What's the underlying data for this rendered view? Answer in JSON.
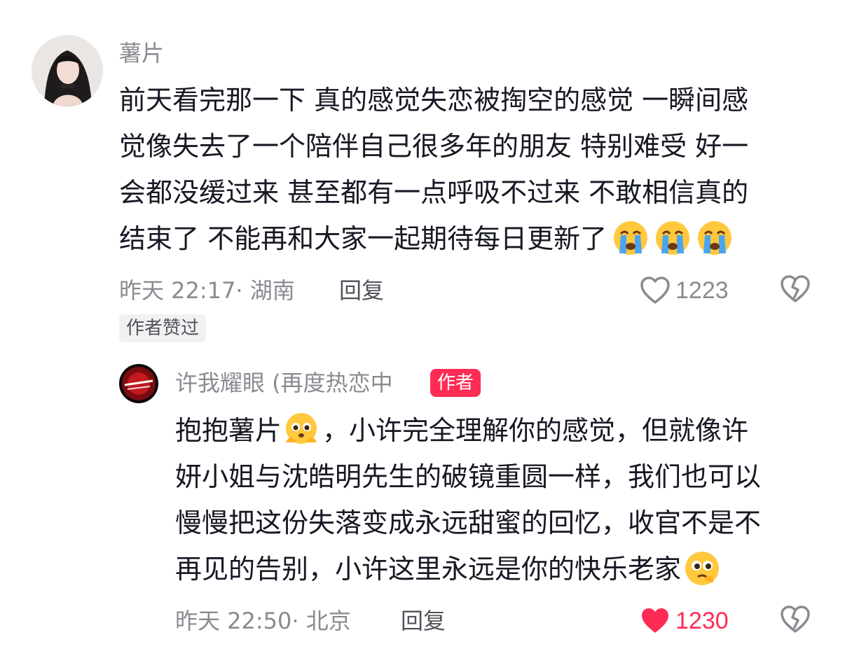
{
  "comment": {
    "username": "薯片",
    "text_lines": [
      "前天看完那一下 真的感觉失恋被掏空的感觉 一瞬间感",
      "觉像失去了一个陪伴自己很多年的朋友 特别难受 好一",
      "会都没缓过来 甚至都有一点呼吸不过来 不敢相信真的",
      "结束了 不能再和大家一起期待每日更新了"
    ],
    "trailing_emojis": [
      "crying-emoji",
      "crying-emoji",
      "crying-emoji"
    ],
    "meta": "昨天 22:17· 湖南",
    "reply_label": "回复",
    "like_count": "1223",
    "liked_by_author_tag": "作者赞过"
  },
  "reply": {
    "username": "许我耀眼 (再度热恋中",
    "author_badge": "作者",
    "text_lines": [
      "抱抱薯片",
      "，小许完全理解你的感觉，但就像许",
      "妍小姐与沈皓明先生的破镜重圆一样，我们也可以",
      "慢慢把这份失落变成永远甜蜜的回忆，收官不是不",
      "再见的告别，小许这里永远是你的快乐老家"
    ],
    "emojis": [
      "hug-emoji",
      "pleading-emoji"
    ],
    "meta": "昨天 22:50· 北京",
    "reply_label": "回复",
    "like_count": "1230",
    "liked": true
  },
  "colors": {
    "accent": "#fe2c55",
    "muted": "#8a8b91",
    "text": "#161823"
  }
}
